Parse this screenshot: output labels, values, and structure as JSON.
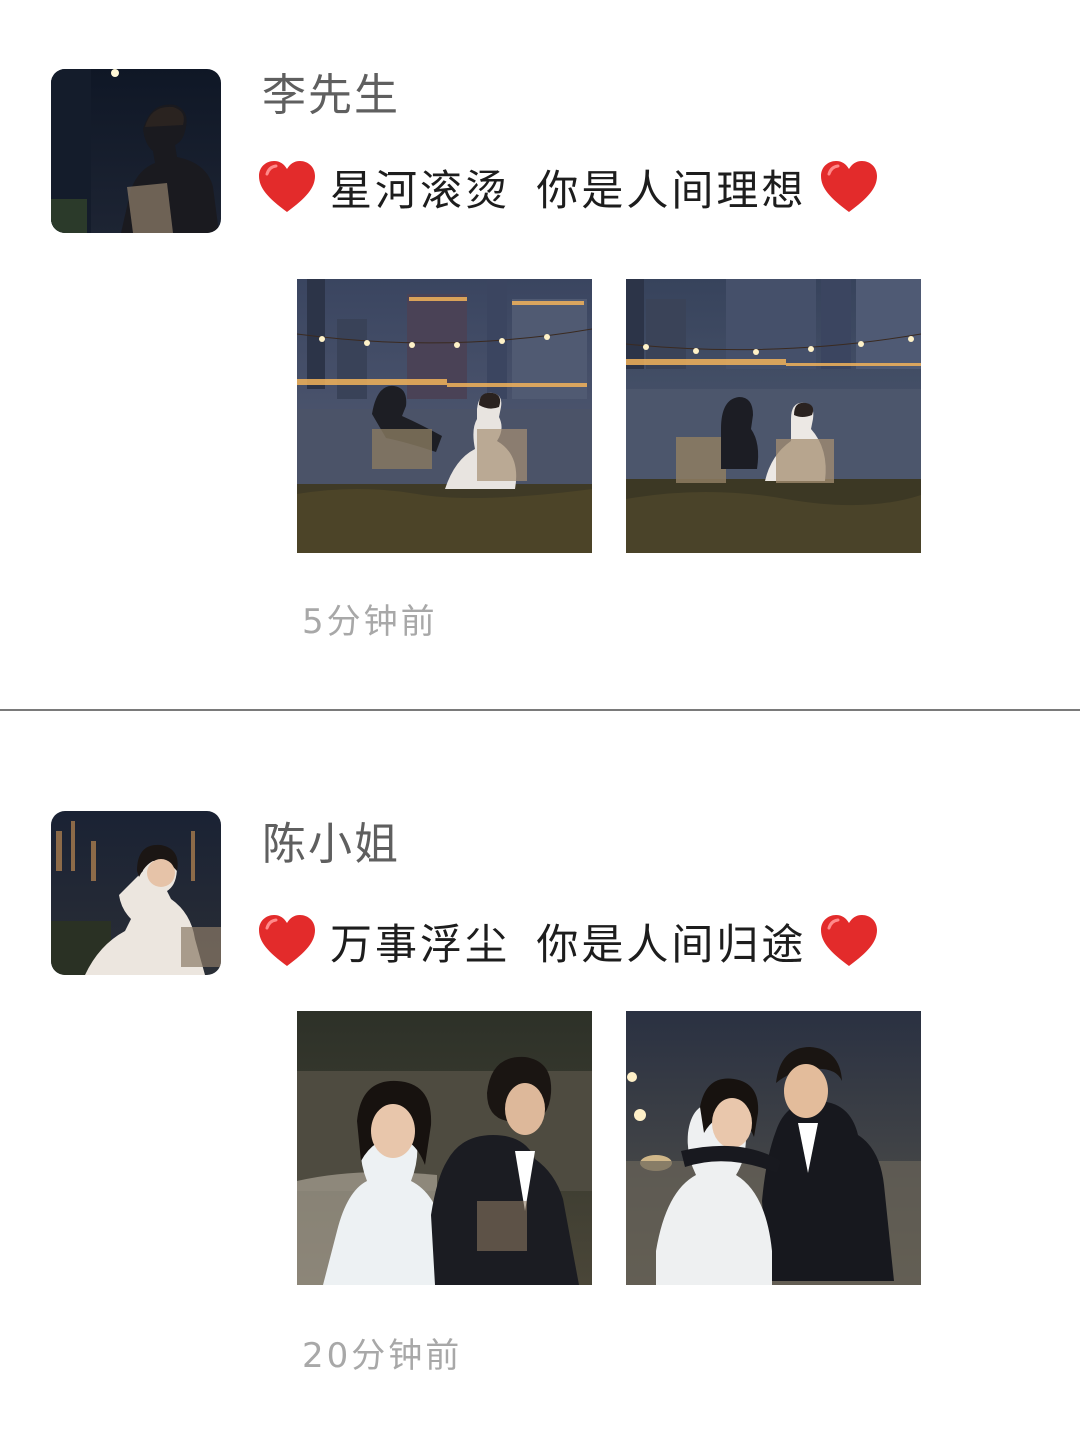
{
  "posts": [
    {
      "author": "李先生",
      "caption": "星河滚烫 你是人间理想",
      "time": "5分钟前",
      "avatar_icon": "man-silhouette-night-avatar",
      "photos": [
        {
          "icon": "couple-seated-riverside-night-photo"
        },
        {
          "icon": "couple-seated-riverside-night-photo"
        }
      ]
    },
    {
      "author": "陈小姐",
      "caption": "万事浮尘 你是人间归途",
      "time": "20分钟前",
      "avatar_icon": "woman-in-white-dress-avatar",
      "photos": [
        {
          "icon": "bride-groom-smiling-photo"
        },
        {
          "icon": "bride-groom-embracing-photo"
        }
      ]
    }
  ],
  "heart_icon": "red-heart-icon",
  "colors": {
    "heart": "#e32b2b",
    "author": "#5f5f5f",
    "caption": "#1d1d1d",
    "timestamp": "#a8a8a8",
    "divider": "#7a7a7a"
  }
}
